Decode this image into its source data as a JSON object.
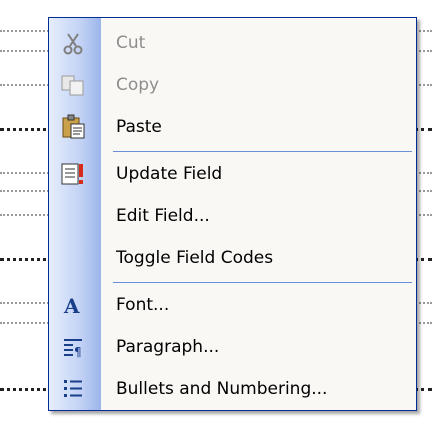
{
  "menu": {
    "items": [
      {
        "label": "Cut",
        "icon": "scissors-icon",
        "enabled": false
      },
      {
        "label": "Copy",
        "icon": "copy-icon",
        "enabled": false
      },
      {
        "label": "Paste",
        "icon": "paste-icon",
        "enabled": true
      },
      {
        "label": "Update Field",
        "icon": "update-field-icon",
        "enabled": true
      },
      {
        "label": "Edit Field...",
        "icon": "",
        "enabled": true
      },
      {
        "label": "Toggle Field Codes",
        "icon": "",
        "enabled": true
      },
      {
        "label": "Font...",
        "icon": "font-icon",
        "enabled": true
      },
      {
        "label": "Paragraph...",
        "icon": "paragraph-icon",
        "enabled": true
      },
      {
        "label": "Bullets and Numbering...",
        "icon": "bullets-icon",
        "enabled": true
      }
    ]
  },
  "colors": {
    "menu_border": "#002d96",
    "gutter": "#c3d3f5",
    "separator": "#6b8fd6",
    "disabled_text": "#8d8d8d"
  }
}
